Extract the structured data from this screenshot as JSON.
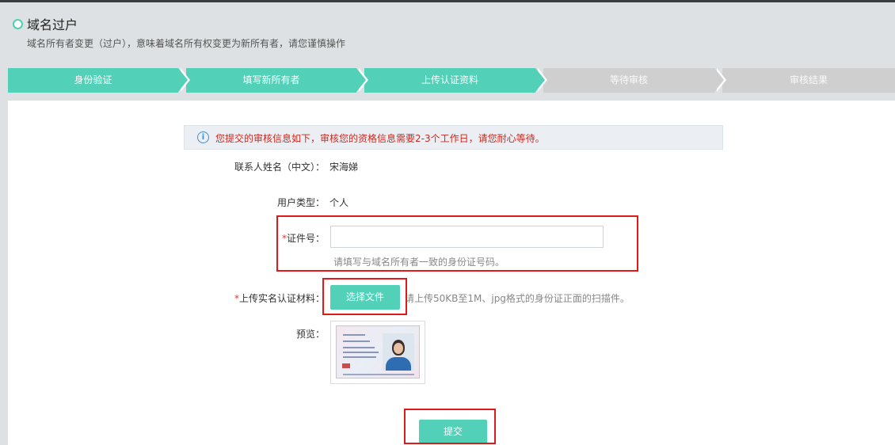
{
  "header": {
    "title": "域名过户",
    "subtitle": "域名所有者变更（过户），意味着域名所有权变更为新所有者，请您谨慎操作"
  },
  "steps": [
    {
      "label": "身份验证",
      "status": "done"
    },
    {
      "label": "填写新所有者",
      "status": "done"
    },
    {
      "label": "上传认证资料",
      "status": "done"
    },
    {
      "label": "等待审核",
      "status": "todo"
    },
    {
      "label": "审核结果",
      "status": "todo"
    }
  ],
  "notice": {
    "icon": "info-icon",
    "text": "您提交的审核信息如下，审核您的资格信息需要2-3个工作日，请您耐心等待。"
  },
  "form": {
    "contact_name_label": "联系人姓名（中文）：",
    "contact_name_value": "宋海娣",
    "user_type_label": "用户类型：",
    "user_type_value": "个人",
    "required_mark": "*",
    "id_number_label": "证件号：",
    "id_number_value": "",
    "id_number_hint": "请填写与域名所有者一致的身份证号码。",
    "upload_label": "上传实名认证材料：",
    "upload_button": "选择文件",
    "upload_hint": "请上传50KB至1M、jpg格式的身份证正面的扫描件。",
    "preview_label": "预览：",
    "submit_button": "提交"
  },
  "colors": {
    "accent": "#52d1b8",
    "step_inactive": "#cfcfcf",
    "notice_text": "#d0281e",
    "highlight": "#e01919"
  }
}
